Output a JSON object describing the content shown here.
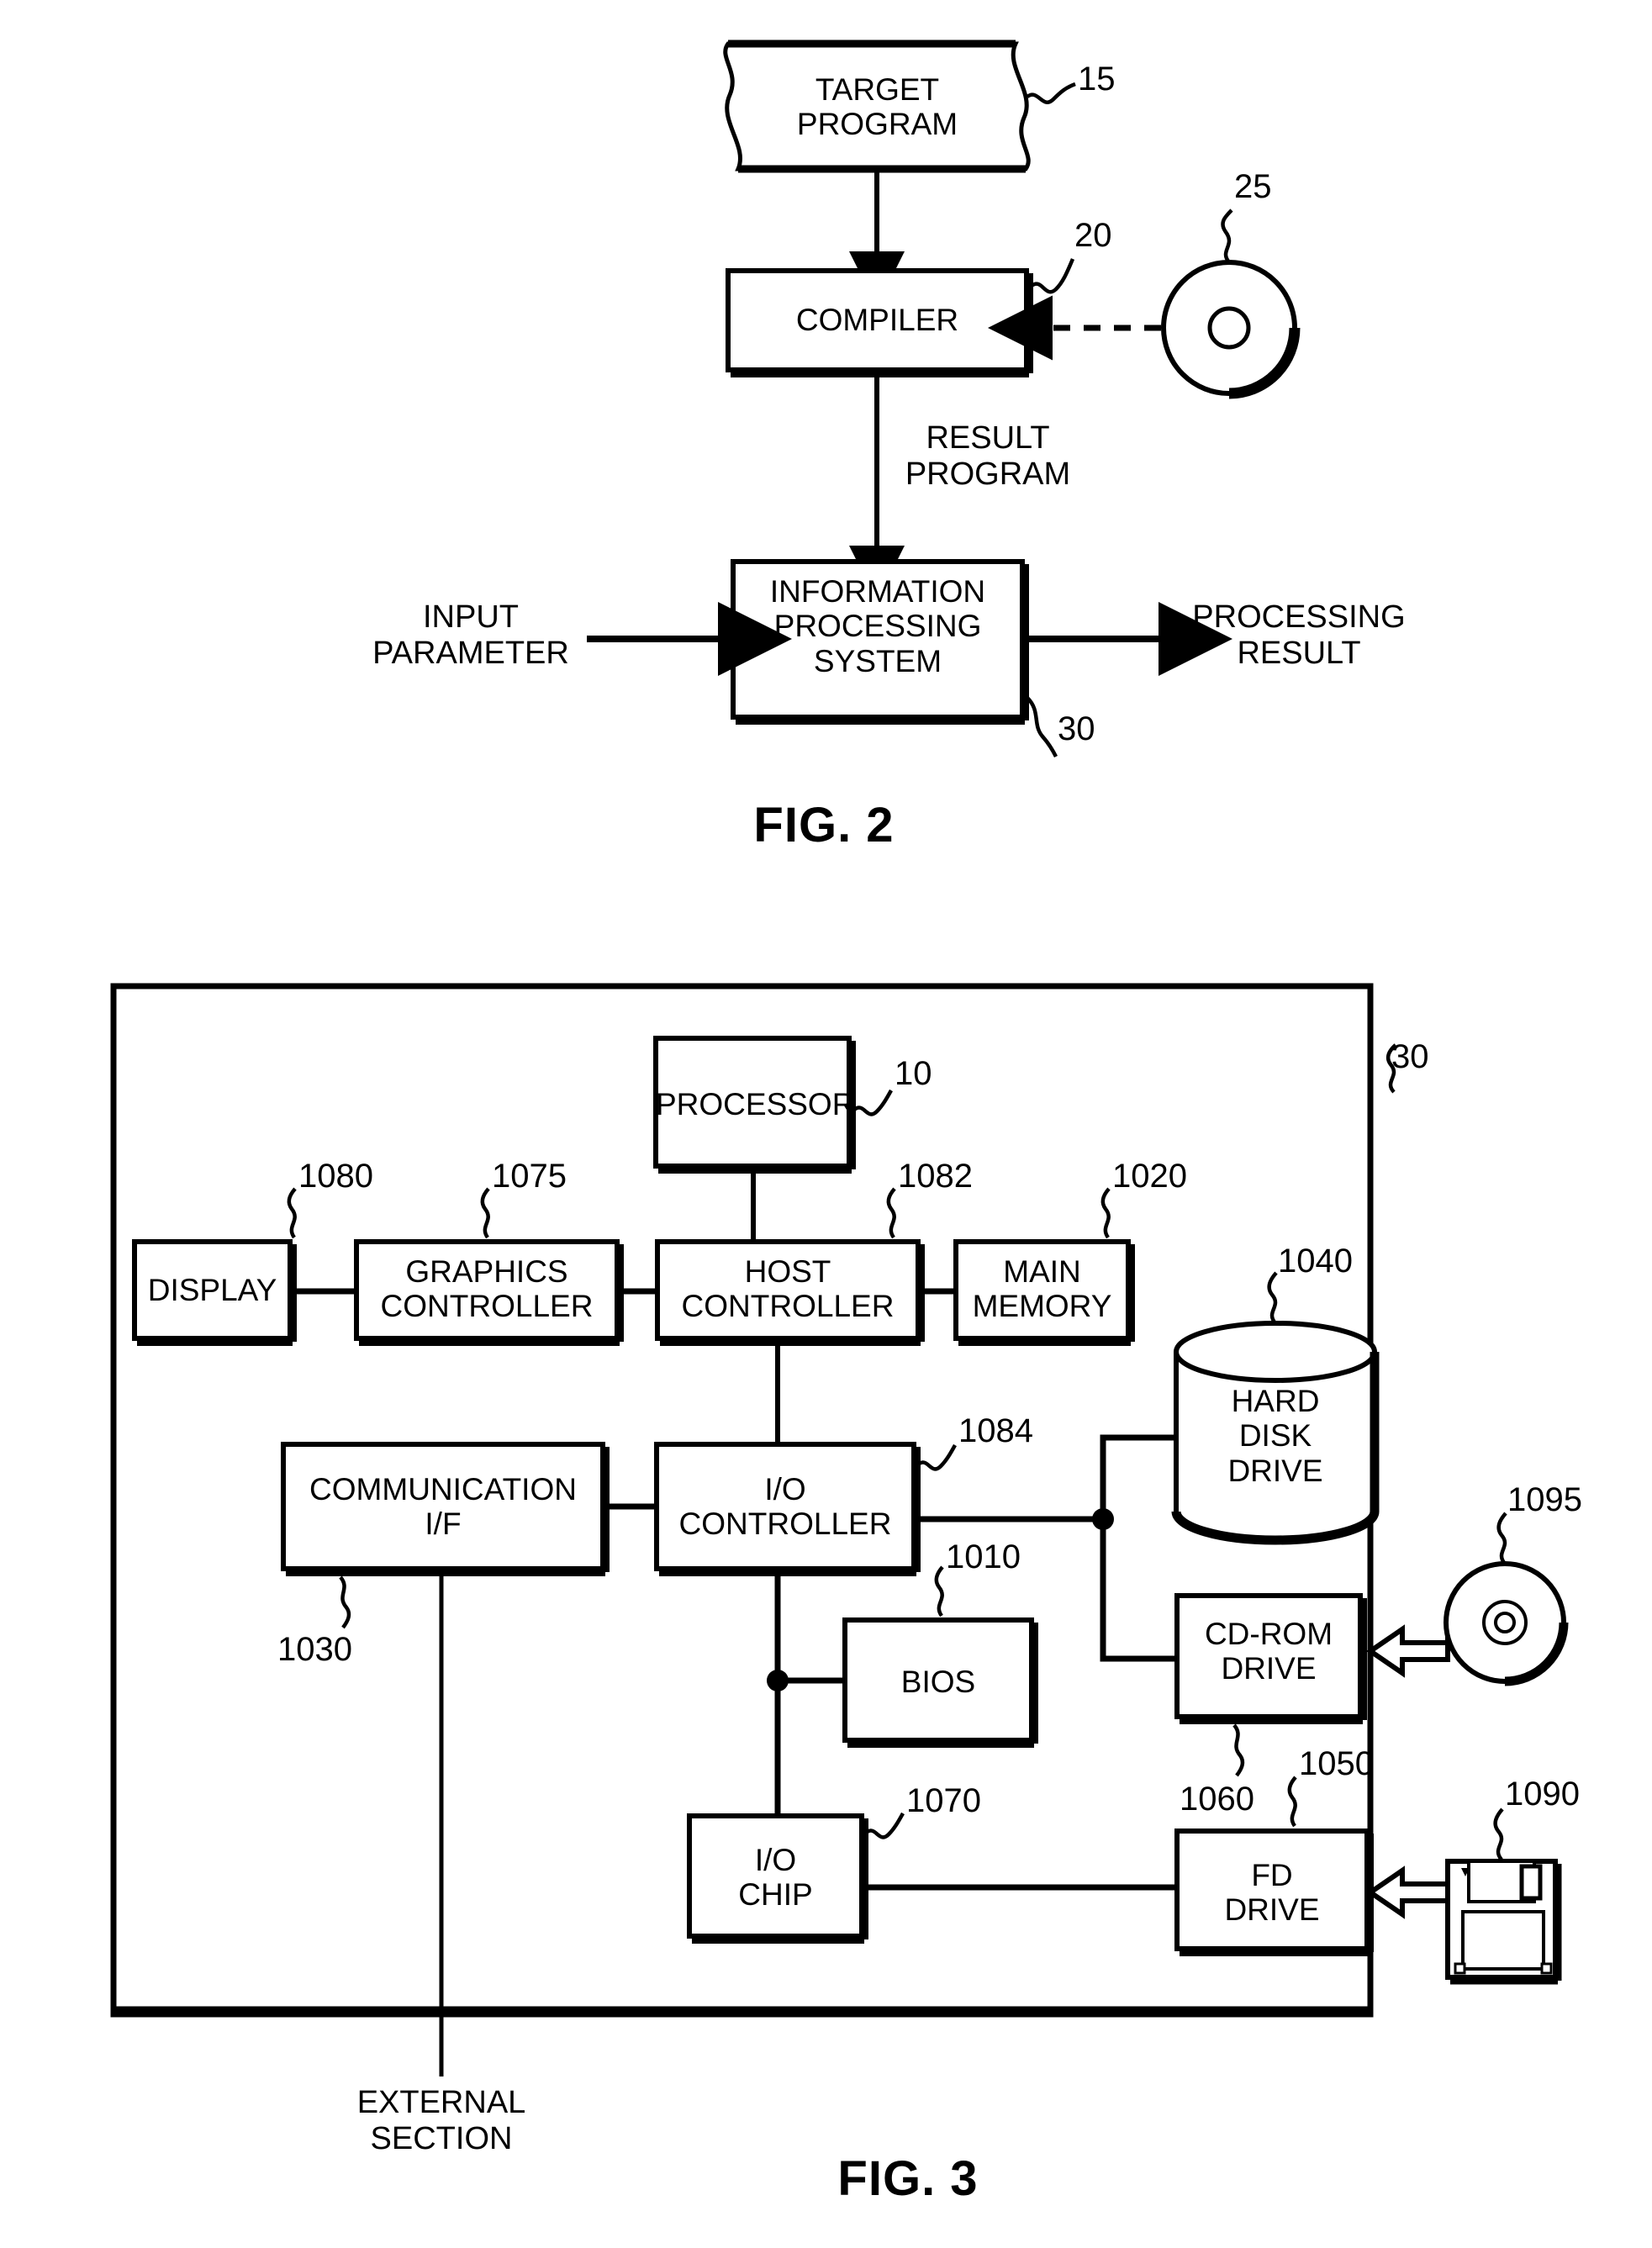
{
  "figures": [
    {
      "id": "fig2",
      "caption": "FIG. 2",
      "nodes": {
        "target_program": "TARGET\nPROGRAM",
        "compiler": "COMPILER",
        "info_processing_system": "INFORMATION\nPROCESSING\nSYSTEM"
      },
      "labels": {
        "result_program": "RESULT\nPROGRAM",
        "input_parameter": "INPUT\nPARAMETER",
        "processing_result": "PROCESSING\nRESULT"
      },
      "refs": {
        "target_program": "15",
        "compiler": "20",
        "media": "25",
        "system": "30"
      },
      "icons": {
        "media": "optical-disc-icon"
      }
    },
    {
      "id": "fig3",
      "caption": "FIG. 3",
      "nodes": {
        "processor": "PROCESSOR",
        "display": "DISPLAY",
        "graphics_controller": "GRAPHICS\nCONTROLLER",
        "host_controller": "HOST\nCONTROLLER",
        "main_memory": "MAIN\nMEMORY",
        "hard_disk_drive": "HARD\nDISK\nDRIVE",
        "communication_if": "COMMUNICATION\nI/F",
        "io_controller": "I/O\nCONTROLLER",
        "cd_rom_drive": "CD-ROM\nDRIVE",
        "bios": "BIOS",
        "io_chip": "I/O\nCHIP",
        "fd_drive": "FD\nDRIVE"
      },
      "labels": {
        "external_section": "EXTERNAL\nSECTION"
      },
      "refs": {
        "processor": "10",
        "display": "1080",
        "graphics_controller": "1075",
        "host_controller": "1082",
        "main_memory": "1020",
        "hard_disk_drive": "1040",
        "communication_if": "1030",
        "io_controller": "1084",
        "bios": "1010",
        "cd_rom_drive": "1060",
        "fd_drive": "1050",
        "io_chip": "1070",
        "cd_media": "1095",
        "fd_media": "1090",
        "system_frame": "30"
      },
      "icons": {
        "cd_media": "optical-disc-icon",
        "fd_media": "floppy-disk-icon",
        "cd_insert": "block-arrow-left-icon",
        "fd_insert": "block-arrow-left-icon"
      }
    }
  ]
}
